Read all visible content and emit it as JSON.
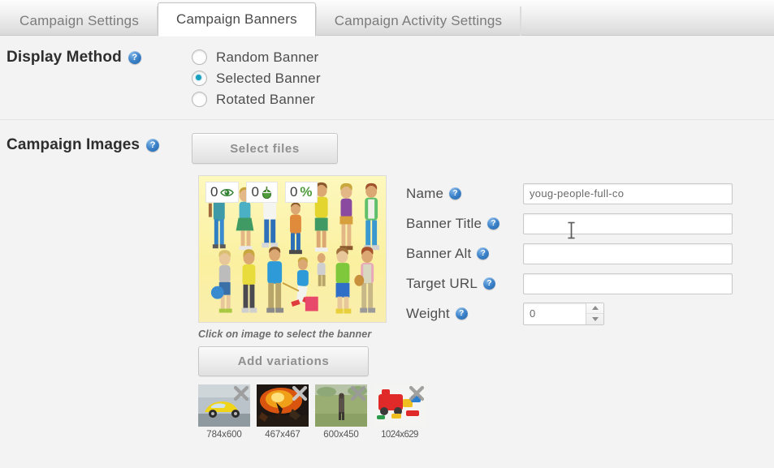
{
  "tabs": [
    {
      "label": "Campaign Settings",
      "active": false
    },
    {
      "label": "Campaign Banners",
      "active": true
    },
    {
      "label": "Campaign Activity Settings",
      "active": false
    }
  ],
  "display_method": {
    "label": "Display Method",
    "help_icon": "help-circle-icon",
    "options": [
      {
        "label": "Random Banner",
        "selected": false
      },
      {
        "label": "Selected Banner",
        "selected": true
      },
      {
        "label": "Rotated Banner",
        "selected": false
      }
    ],
    "selected_value": "Selected Banner"
  },
  "campaign_images": {
    "label": "Campaign Images",
    "help_icon": "help-circle-icon",
    "select_files_label": "Select files",
    "add_variations_label": "Add variations",
    "hint": "Click on image to select the banner"
  },
  "banner": {
    "stats": {
      "impressions": "0",
      "impressions_icon": "eye-icon",
      "clicks": "0",
      "clicks_icon": "mouse-click-icon",
      "ctr": "0",
      "ctr_unit": "%"
    },
    "variations": [
      {
        "size": "784x600",
        "remove_icon": "close-x-icon"
      },
      {
        "size": "467x467",
        "remove_icon": "close-x-icon"
      },
      {
        "size": "600x450",
        "remove_icon": "close-x-icon"
      },
      {
        "size": "1024x629",
        "remove_icon": "close-x-icon"
      }
    ]
  },
  "form": {
    "name": {
      "label": "Name",
      "value": "youg-people-full-co",
      "placeholder": ""
    },
    "banner_title": {
      "label": "Banner Title",
      "value": "",
      "placeholder": ""
    },
    "banner_alt": {
      "label": "Banner Alt",
      "value": "",
      "placeholder": ""
    },
    "target_url": {
      "label": "Target URL",
      "value": "",
      "placeholder": ""
    },
    "weight": {
      "label": "Weight",
      "value": "0",
      "placeholder": ""
    }
  },
  "colors": {
    "radio_accent": "#18a0be",
    "help_blue": "#3d82c9",
    "ctr_green": "#4f9b3c",
    "banner_bg": "#fcf2a6",
    "page_bg": "#f3f3f3"
  }
}
